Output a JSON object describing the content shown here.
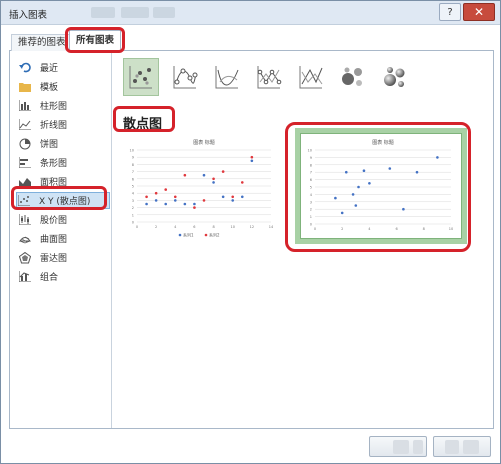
{
  "window": {
    "title": "插入图表"
  },
  "tabs": [
    {
      "label": "推荐的图表"
    },
    {
      "label": "所有图表"
    }
  ],
  "sidebar": {
    "items": [
      {
        "label": "最近",
        "icon": "undo-arrow-icon"
      },
      {
        "label": "模板",
        "icon": "folder-icon"
      },
      {
        "label": "柱形图",
        "icon": "column-chart-icon"
      },
      {
        "label": "折线图",
        "icon": "line-chart-icon"
      },
      {
        "label": "饼图",
        "icon": "pie-chart-icon"
      },
      {
        "label": "条形图",
        "icon": "bar-chart-icon"
      },
      {
        "label": "面积图",
        "icon": "area-chart-icon"
      },
      {
        "label": "X Y (散点图)",
        "icon": "scatter-chart-icon"
      },
      {
        "label": "股价图",
        "icon": "stock-chart-icon"
      },
      {
        "label": "曲面图",
        "icon": "surface-chart-icon"
      },
      {
        "label": "雷达图",
        "icon": "radar-chart-icon"
      },
      {
        "label": "组合",
        "icon": "combo-chart-icon"
      }
    ],
    "selected_index": 7
  },
  "chart_types": [
    "scatter-icon",
    "scatter-smooth-lines-markers-icon",
    "scatter-smooth-lines-icon",
    "scatter-straight-lines-markers-icon",
    "scatter-straight-lines-icon",
    "bubble-icon",
    "3d-bubble-icon"
  ],
  "section": {
    "heading": "散点图"
  },
  "previews": [
    {
      "title": "图表 标题",
      "chart_data": {
        "type": "scatter",
        "xlim": [
          0,
          14
        ],
        "ylim": [
          0,
          10
        ],
        "x_ticks": [
          "0",
          "2",
          "4",
          "6",
          "8",
          "10",
          "12",
          "14"
        ],
        "y_ticks": [
          "0",
          "1",
          "2",
          "3",
          "4",
          "5",
          "6",
          "7",
          "8",
          "9",
          "10"
        ],
        "legend_position": "bottom",
        "series": [
          {
            "name": "系列1",
            "color": "#4472c4",
            "points": [
              [
                1,
                2.5
              ],
              [
                2,
                3
              ],
              [
                3,
                2.5
              ],
              [
                4,
                3
              ],
              [
                5,
                2.5
              ],
              [
                6,
                2.5
              ],
              [
                7,
                6.5
              ],
              [
                8,
                5.5
              ],
              [
                9,
                3.5
              ],
              [
                10,
                3
              ],
              [
                11,
                3.5
              ],
              [
                12,
                8.5
              ]
            ]
          },
          {
            "name": "系列2",
            "color": "#e0393e",
            "points": [
              [
                1,
                3.5
              ],
              [
                2,
                4
              ],
              [
                3,
                4.5
              ],
              [
                4,
                3.5
              ],
              [
                5,
                6.5
              ],
              [
                6,
                2
              ],
              [
                7,
                3
              ],
              [
                8,
                6
              ],
              [
                9,
                7
              ],
              [
                10,
                3.5
              ],
              [
                11,
                5.5
              ],
              [
                12,
                9
              ]
            ]
          }
        ]
      }
    },
    {
      "title": "图表 标题",
      "chart_data": {
        "type": "scatter",
        "xlim": [
          0,
          10
        ],
        "ylim": [
          0,
          10
        ],
        "x_ticks": [
          "0",
          "2",
          "4",
          "6",
          "8",
          "10"
        ],
        "y_ticks": [
          "0",
          "1",
          "2",
          "3",
          "4",
          "5",
          "6",
          "7",
          "8",
          "9",
          "10"
        ],
        "series": [
          {
            "color": "#4472c4",
            "points": [
              [
                1.5,
                3.5
              ],
              [
                2,
                1.5
              ],
              [
                2.3,
                7
              ],
              [
                2.8,
                4
              ],
              [
                3,
                2.5
              ],
              [
                3.2,
                5
              ],
              [
                3.6,
                7.2
              ],
              [
                4,
                5.5
              ],
              [
                5.5,
                7.5
              ],
              [
                6.5,
                2
              ],
              [
                7.5,
                7
              ],
              [
                9,
                9
              ]
            ]
          }
        ]
      }
    }
  ]
}
